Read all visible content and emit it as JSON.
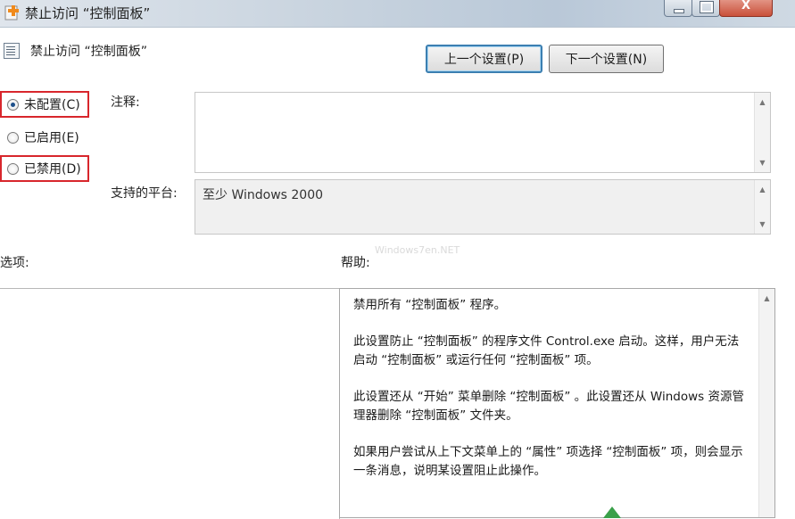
{
  "window": {
    "title": "禁止访问 “控制面板”",
    "close_glyph": "X"
  },
  "policy": {
    "name": "禁止访问 “控制面板”"
  },
  "nav": {
    "prev_label": "上一个设置(P)",
    "next_label": "下一个设置(N)"
  },
  "state": {
    "options": [
      {
        "label": "未配置(C)",
        "checked": true,
        "highlighted": true
      },
      {
        "label": "已启用(E)",
        "checked": false,
        "highlighted": false
      },
      {
        "label": "已禁用(D)",
        "checked": false,
        "highlighted": true
      }
    ]
  },
  "comment": {
    "label": "注释:",
    "value": ""
  },
  "platform": {
    "label": "支持的平台:",
    "value": "至少 Windows 2000"
  },
  "options_pane": {
    "label": "选项:"
  },
  "help": {
    "label": "帮助:",
    "paragraphs": [
      "禁用所有 “控制面板” 程序。",
      "此设置防止 “控制面板” 的程序文件 Control.exe 启动。这样，用户无法启动 “控制面板” 或运行任何 “控制面板” 项。",
      "此设置还从 “开始” 菜单删除 “控制面板” 。此设置还从 Windows 资源管理器删除 “控制面板” 文件夹。",
      "如果用户尝试从上下文菜单上的 “属性” 项选择 “控制面板” 项，则会显示一条消息，说明某设置阻止此操作。"
    ]
  },
  "watermark": "Windows7en.NET",
  "colors": {
    "highlight_border": "#d8262c",
    "focus_button_border": "#3c7fb1",
    "radio_dot": "#1d4f8a"
  }
}
